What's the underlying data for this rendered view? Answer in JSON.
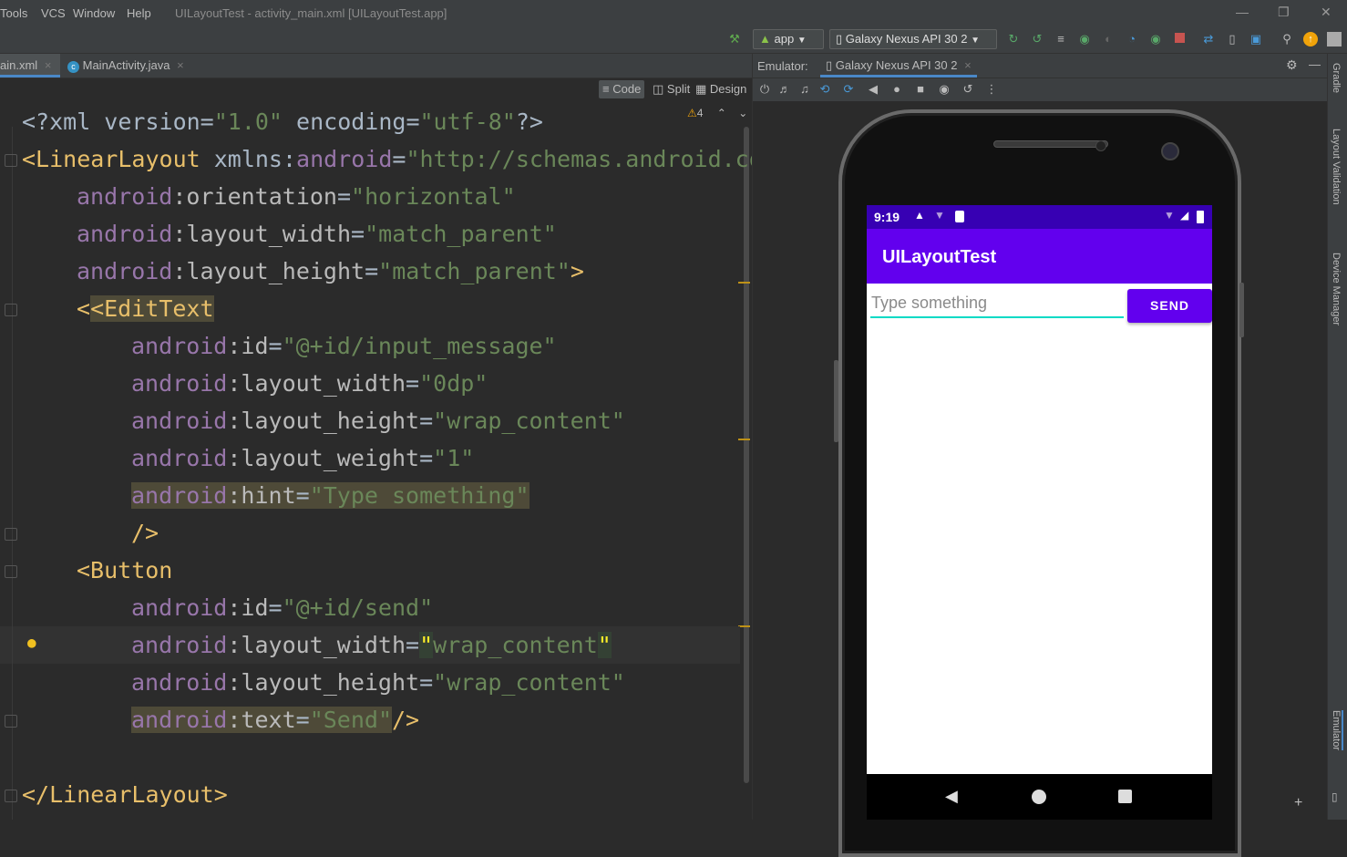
{
  "menubar": {
    "items": [
      "Tools",
      "VCS",
      "Window",
      "Help"
    ],
    "window_title": "UILayoutTest - activity_main.xml [UILayoutTest.app]"
  },
  "toolbar": {
    "run_config": "app",
    "device": "Galaxy Nexus API 30 2"
  },
  "editor_tabs": [
    {
      "label": "ain.xml",
      "active": true
    },
    {
      "label": "MainActivity.java",
      "active": false
    }
  ],
  "view_modes": {
    "code": "Code",
    "split": "Split",
    "design": "Design"
  },
  "inspection": {
    "warning_count": "4"
  },
  "emulator": {
    "header_label": "Emulator:",
    "device_tab": "Galaxy Nexus API 30 2"
  },
  "side_tools": [
    "Gradle",
    "Layout Validation",
    "Device Manager",
    "Emulator"
  ],
  "code": {
    "l1": {
      "a": "<?xml version=",
      "b": "\"1.0\"",
      "c": " encoding=",
      "d": "\"utf-8\"",
      "e": "?>"
    },
    "l2": {
      "tag": "<LinearLayout",
      "c": " xmlns:",
      "ns": "android",
      "eq": "=",
      "val": "\"http://schemas.android.co"
    },
    "l3": {
      "ns": "android",
      "attr": ":orientation",
      "eq": "=",
      "val": "\"horizontal\""
    },
    "l4": {
      "ns": "android",
      "attr": ":layout_width",
      "eq": "=",
      "val": "\"match_parent\""
    },
    "l5": {
      "ns": "android",
      "attr": ":layout_height",
      "eq": "=",
      "val": "\"match_parent\"",
      "end": ">"
    },
    "l6": {
      "tag": "<EditText"
    },
    "l7": {
      "ns": "android",
      "attr": ":id",
      "eq": "=",
      "val": "\"@+id/input_message\""
    },
    "l8": {
      "ns": "android",
      "attr": ":layout_width",
      "eq": "=",
      "val": "\"0dp\""
    },
    "l9": {
      "ns": "android",
      "attr": ":layout_height",
      "eq": "=",
      "val": "\"wrap_content\""
    },
    "l10": {
      "ns": "android",
      "attr": ":layout_weight",
      "eq": "=",
      "val": "\"1\""
    },
    "l11": {
      "ns": "android",
      "attr": ":hint",
      "eq": "=",
      "val": "\"Type something\""
    },
    "l12": {
      "tag": "/>"
    },
    "l13": {
      "tag": "<Button"
    },
    "l14": {
      "ns": "android",
      "attr": ":id",
      "eq": "=",
      "val": "\"@+id/send\""
    },
    "l15": {
      "ns": "android",
      "attr": ":layout_width",
      "eq": "=",
      "q1": "\"",
      "val": "wrap_content",
      "q2": "\""
    },
    "l16": {
      "ns": "android",
      "attr": ":layout_height",
      "eq": "=",
      "val": "\"wrap_content\""
    },
    "l17": {
      "ns": "android",
      "attr": ":text",
      "eq": "=",
      "val": "\"Send\"",
      "end": "/>"
    },
    "l19": {
      "tag": "</LinearLayout>"
    }
  },
  "device_screen": {
    "time": "9:19",
    "app_title": "UILayoutTest",
    "input_hint": "Type something",
    "send_button": "SEND"
  },
  "colors": {
    "status_bar": "#3700b3",
    "app_bar": "#6200ee",
    "button": "#6200ee",
    "input_underline": "#03dac5"
  }
}
